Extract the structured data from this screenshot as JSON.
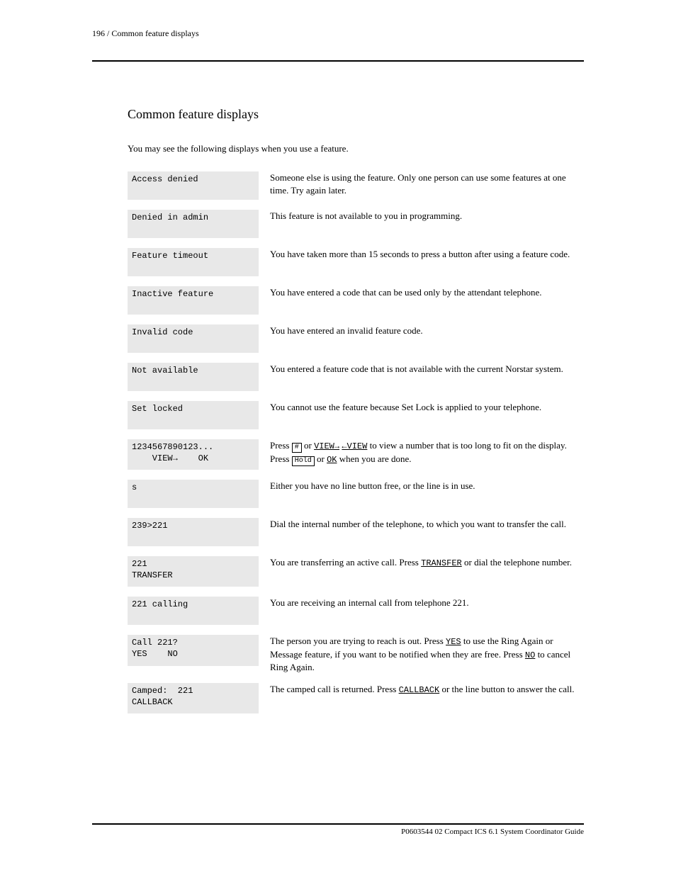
{
  "header": {
    "left": "196 / Common feature displays",
    "right": ""
  },
  "section_title": "Common feature displays",
  "intro": "You may see the following displays when you use a feature.",
  "entries": [
    {
      "panel": {
        "l1": "Access denied",
        "l2": ""
      },
      "desc": "Someone else is using the feature. Only one person can use some features at one time. Try again later."
    },
    {
      "panel": {
        "l1": "Denied in admin",
        "l2": ""
      },
      "desc": "This feature is not available to you in programming."
    },
    {
      "panel": {
        "l1": "Feature timeout",
        "l2": ""
      },
      "desc": "You have taken more than 15 seconds to press a button after using a feature code."
    },
    {
      "panel": {
        "l1": "Inactive feature",
        "l2": ""
      },
      "desc": "You have entered a code that can be used only by the attendant telephone."
    },
    {
      "panel": {
        "l1": "Invalid code",
        "l2": ""
      },
      "desc": "You have entered an invalid feature code."
    },
    {
      "panel": {
        "l1": "Not available",
        "l2": ""
      },
      "desc": "You entered a feature code that is not available with the current Norstar system."
    },
    {
      "panel": {
        "l1": "Set locked",
        "l2": ""
      },
      "desc": "You cannot use the feature because Set Lock is applied to your telephone."
    },
    {
      "panel": {
        "l1": "1234567890123...",
        "l2": "    VIEW→    OK"
      },
      "desc_html": "Press <span class='keycap'>#</span> or <span class='inline-mono inline-underline'>VIEW→</span> <span class='inline-mono inline-underline'>←VIEW</span> to view a number that is too long to fit on the display. Press <span class='keycap'>Hold</span> or <span class='inline-mono inline-underline'>OK</span> when you are done."
    },
    {
      "panel": {
        "l1": "s",
        "l2": ""
      },
      "desc": "Either you have no line button free, or the line is in use."
    },
    {
      "panel": {
        "l1": "239>221",
        "l2": ""
      },
      "desc": "Dial the internal number of the telephone, to which you want to transfer the call."
    },
    {
      "panel": {
        "l1": "221",
        "l2": "TRANSFER"
      },
      "desc_html": "You are transferring an active call. Press <span class='inline-mono inline-underline'>TRANSFER</span> or dial the telephone number."
    },
    {
      "panel": {
        "l1": "221 calling",
        "l2": ""
      },
      "desc": "You are receiving an internal call from telephone 221."
    },
    {
      "panel": {
        "l1": "Call 221?",
        "l2": "YES    NO"
      },
      "desc_html": "The person you are trying to reach is out. Press <span class='inline-mono inline-underline'>YES</span> to use the Ring Again or Message feature, if you want to be notified when they are free. Press <span class='inline-mono inline-underline'>NO</span> to cancel Ring Again."
    },
    {
      "panel": {
        "l1": "Camped:  221",
        "l2": "CALLBACK"
      },
      "desc_html": "The camped call is returned. Press <span class='inline-mono inline-underline'>CALLBACK</span> or the line button to answer the call."
    }
  ],
  "footer": "P0603544   02   Compact ICS 6.1 System Coordinator Guide"
}
